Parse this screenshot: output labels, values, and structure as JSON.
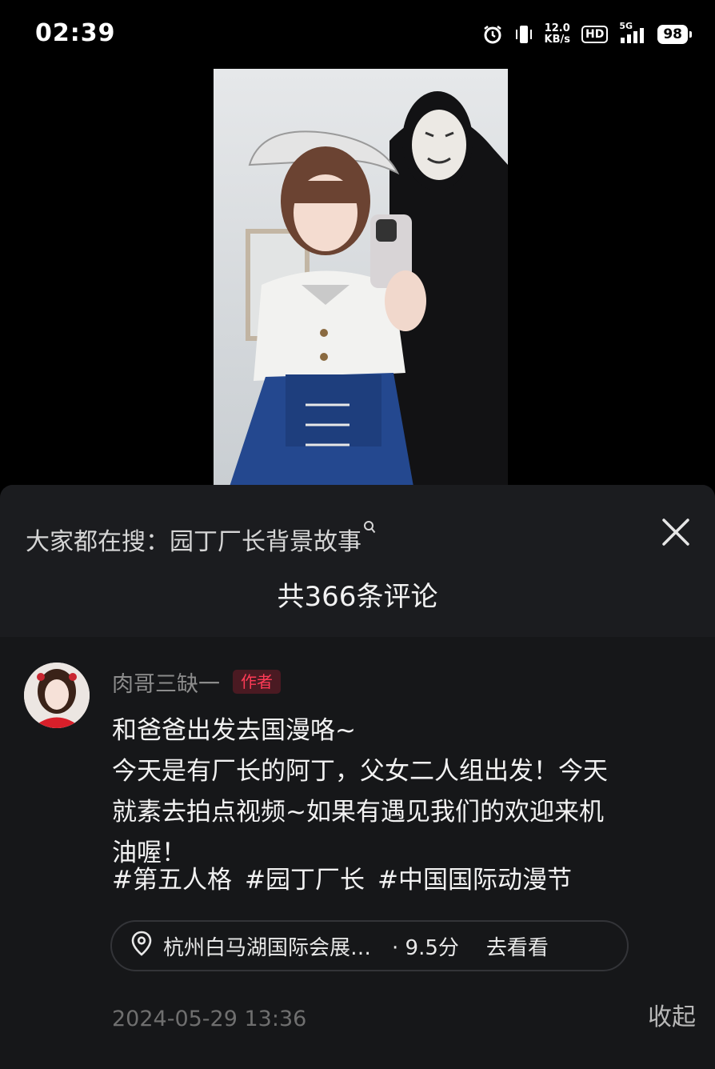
{
  "status_bar": {
    "time": "02:39",
    "net_speed_value": "12.0",
    "net_speed_unit": "KB/s",
    "hd": "HD",
    "network": "5G",
    "battery": "98",
    "icons": [
      "alarm-icon",
      "vibrate-icon",
      "signal-icon",
      "battery-icon"
    ]
  },
  "video": {
    "description_icons": [
      "selfie-girl-lolita-dress",
      "masked-man-hoodie"
    ]
  },
  "panel": {
    "search_hint": "大家都在搜：园丁厂长背景故事",
    "comment_count": "共366条评论"
  },
  "comment": {
    "author": "肉哥三缺一",
    "author_badge": "作者",
    "lines": [
      "和爸爸出发去国漫咯~",
      "今天是有厂长的阿丁，父女二人组出发！今天",
      "就素去拍点视频~如果有遇见我们的欢迎来机",
      "油喔！"
    ],
    "tags": [
      "#第五人格",
      "#园丁厂长",
      "#中国国际动漫节"
    ],
    "location": {
      "name": "杭州白马湖国际会展…",
      "score": "· 9.5分",
      "action": "去看看"
    },
    "date": "2024-05-29 13:36",
    "collapse_label": "收起"
  },
  "colors": {
    "background": "#000000",
    "panel": "#161719",
    "badge_text": "#ff3b56",
    "muted_text": "#8c8c8c"
  }
}
